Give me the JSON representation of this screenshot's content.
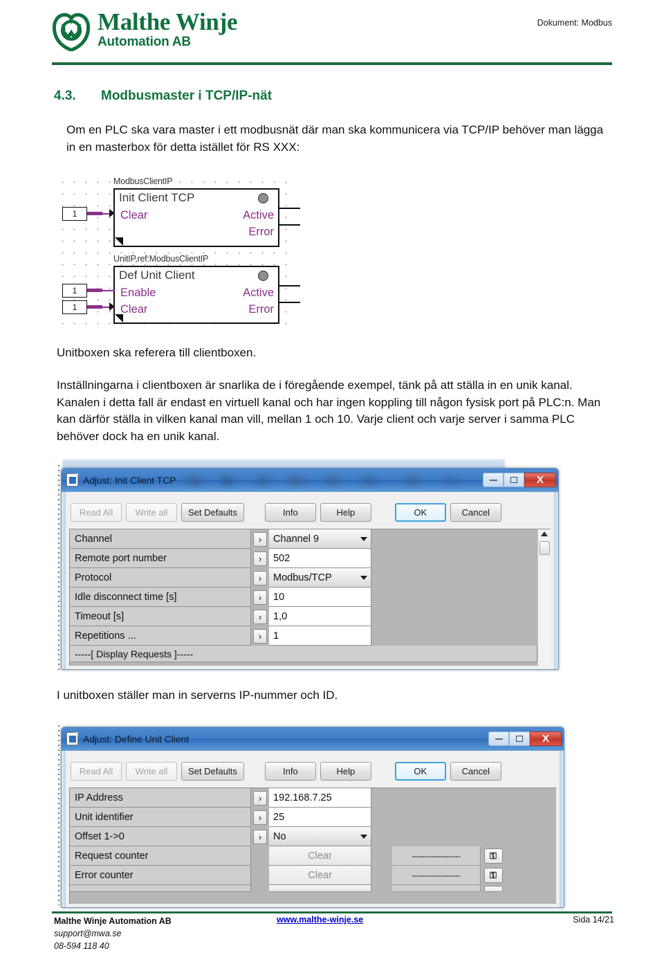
{
  "header": {
    "logo_title": "Malthe Winje",
    "logo_sub": "Automation AB",
    "doc_label": "Dokument: Modbus"
  },
  "section": {
    "number": "4.3.",
    "title": "Modbusmaster i TCP/IP-nät"
  },
  "paragraphs": {
    "intro": "Om en PLC ska vara master i ett modbusnät där man ska kommunicera via TCP/IP behöver man lägga in en masterbox för detta istället för RS XXX:",
    "unitbox": "Unitboxen ska referera till clientboxen.",
    "settings": "Inställningarna i clientboxen är snarlika de i föregående exempel, tänk på att ställa in en unik kanal. Kanalen i detta fall är endast en virtuell kanal och har ingen koppling till någon fysisk port på PLC:n. Man kan därför ställa in vilken kanal man vill, mellan 1 och 10. Varje client och varje server i samma PLC behöver dock ha en unik kanal.",
    "unitbox2": "I unitboxen ställer man in serverns IP-nummer och ID."
  },
  "fbd": {
    "block1": {
      "caption": "ModbusClientIP",
      "title": "Init Client TCP",
      "inputs": [
        {
          "label": "Clear",
          "value": "1"
        }
      ],
      "outputs": [
        "Active",
        "Error"
      ]
    },
    "block2": {
      "caption": "UnitIP,ref:ModbusClientIP",
      "title": "Def Unit Client",
      "inputs": [
        {
          "label": "Enable",
          "value": "1"
        },
        {
          "label": "Clear",
          "value": "1"
        }
      ],
      "outputs": [
        "Active",
        "Error"
      ]
    }
  },
  "dialog1": {
    "title": "Adjust: Init Client TCP",
    "buttons": {
      "read_all": "Read All",
      "write_all": "Write all",
      "set_defaults": "Set Defaults",
      "info": "Info",
      "help": "Help",
      "ok": "OK",
      "cancel": "Cancel"
    },
    "window_controls": {
      "minimize": "",
      "maximize": "",
      "close": "X"
    },
    "rows": [
      {
        "label": "Channel",
        "value": "Channel 9",
        "type": "combo"
      },
      {
        "label": "Remote port number",
        "value": "502",
        "type": "text"
      },
      {
        "label": "Protocol",
        "value": "Modbus/TCP",
        "type": "combo"
      },
      {
        "label": "Idle disconnect time [s]",
        "value": "10",
        "type": "text"
      },
      {
        "label": "Timeout [s]",
        "value": "1,0",
        "type": "text"
      },
      {
        "label": "Repetitions ...",
        "value": "1",
        "type": "text"
      }
    ],
    "footer_row": "-----[ Display Requests ]-----",
    "arrow_glyph": "›"
  },
  "dialog2": {
    "title": "Adjust: Define Unit Client",
    "buttons": {
      "read_all": "Read All",
      "write_all": "Write all",
      "set_defaults": "Set Defaults",
      "info": "Info",
      "help": "Help",
      "ok": "OK",
      "cancel": "Cancel"
    },
    "window_controls": {
      "minimize": "",
      "maximize": "",
      "close": "X"
    },
    "rows": [
      {
        "label": "IP Address",
        "value": "192.168.7.25",
        "type": "text"
      },
      {
        "label": "Unit identifier",
        "value": "25",
        "type": "text"
      },
      {
        "label": "Offset 1->0",
        "value": "No",
        "type": "combo"
      },
      {
        "label": "Request counter",
        "value": "Clear",
        "type": "clear",
        "dashes": "--------------------",
        "key": "key-icon"
      },
      {
        "label": "Error counter",
        "value": "Clear",
        "type": "clear",
        "dashes": "--------------------",
        "key": "key-icon"
      }
    ],
    "arrow_glyph": "›",
    "key_glyph": "⚿"
  },
  "footer": {
    "company": "Malthe Winje Automation AB",
    "email": "support@mwa.se",
    "phone": "08-594 118 40",
    "website": "www.malthe-winje.se",
    "page": "Sida 14/21"
  },
  "colors": {
    "brand_green": "#12713f",
    "rule_green": "#1d6b3c",
    "pin_purple": "#8a2f8a",
    "link_blue": "#0000cc",
    "title_blue": "#3d7cc6",
    "close_red": "#c0392b"
  }
}
